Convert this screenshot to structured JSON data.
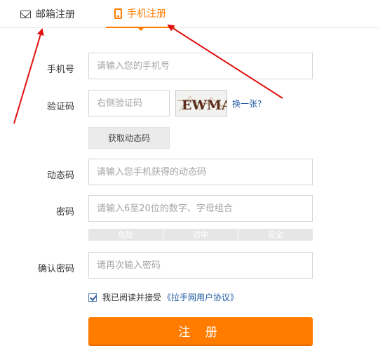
{
  "tabs": {
    "email": "邮箱注册",
    "phone": "手机注册",
    "active": "phone"
  },
  "form": {
    "phone": {
      "label": "手机号",
      "placeholder": "请输入您的手机号"
    },
    "captcha": {
      "label": "验证码",
      "placeholder": "右侧验证码",
      "image_text": "EWMA",
      "refresh_label": "换一张?"
    },
    "get_code_button": "获取动态码",
    "dynamic_code": {
      "label": "动态码",
      "placeholder": "请输入您手机获得的动态码"
    },
    "password": {
      "label": "密码",
      "placeholder": "请输入6至20位的数字、字母组合"
    },
    "strength": [
      "危险",
      "适中",
      "安全"
    ],
    "confirm": {
      "label": "确认密码",
      "placeholder": "请再次输入密码"
    },
    "agreement": {
      "checked": true,
      "text": "我已阅读并接受",
      "link": "《拉手网用户协议》"
    },
    "submit_label": "注 册"
  },
  "colors": {
    "accent": "#ff7c00",
    "link": "#1e5a9e",
    "annotation_arrow": "#e01010"
  }
}
